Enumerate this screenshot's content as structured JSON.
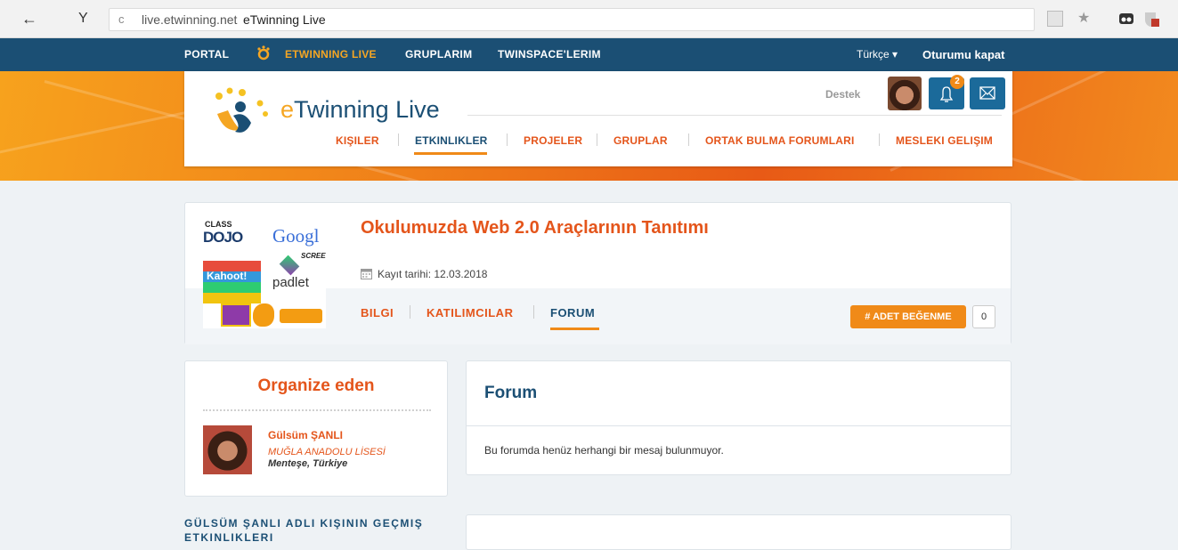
{
  "browser": {
    "url_domain": "live.etwinning.net",
    "tab_title": "eTwinning Live",
    "back_glyph": "←",
    "yandex_glyph": "Y",
    "reload_glyph": "c",
    "star_glyph": "★"
  },
  "topnav": {
    "items": [
      {
        "label": "PORTAL"
      },
      {
        "label": "ETWINNING LIVE"
      },
      {
        "label": "GRUPLARIM"
      },
      {
        "label": "TWINSPACE'LERIM"
      }
    ],
    "language": "Türkçe ▾",
    "logout": "Oturumu kapat"
  },
  "header": {
    "logo_e": "e",
    "logo_rest": "Twinning Live",
    "support": "Destek",
    "notification_count": "2",
    "nav": [
      {
        "label": "KIŞILER"
      },
      {
        "label": "ETKINLIKLER"
      },
      {
        "label": "PROJELER"
      },
      {
        "label": "GRUPLAR"
      },
      {
        "label": "ORTAK BULMA FORUMLARI"
      },
      {
        "label": "MESLEKI GELIŞIM"
      }
    ]
  },
  "project": {
    "title": "Okulumuzda Web 2.0 Araçlarının Tanıtımı",
    "registered_label": "Kayıt tarihi:",
    "registered_date": "12.03.2018",
    "tabs": [
      {
        "label": "BILGI"
      },
      {
        "label": "KATILIMCILAR"
      },
      {
        "label": "FORUM"
      }
    ],
    "like_button": "# ADET BEĞENME",
    "like_count": "0",
    "image_labels": {
      "class": "CLASS",
      "dojo": "DOJO",
      "google": "Googl",
      "screen": "SCREEN",
      "kahoot": "Kahoot!",
      "padlet": "padlet"
    }
  },
  "organizer": {
    "title": "Organize eden",
    "name": "Gülsüm ŞANLI",
    "school": "MUĞLA ANADOLU LİSESİ",
    "location": "Menteşe, Türkiye"
  },
  "forum": {
    "title": "Forum",
    "empty_message": "Bu forumda henüz herhangi bir mesaj bulunmuyor."
  },
  "past_events_title": "GÜLSÜM ŞANLI ADLI KIŞININ GEÇMIŞ ETKINLIKLERI",
  "colors": {
    "navy": "#1b4f74",
    "orange": "#e4551b",
    "accent": "#f08a18"
  }
}
